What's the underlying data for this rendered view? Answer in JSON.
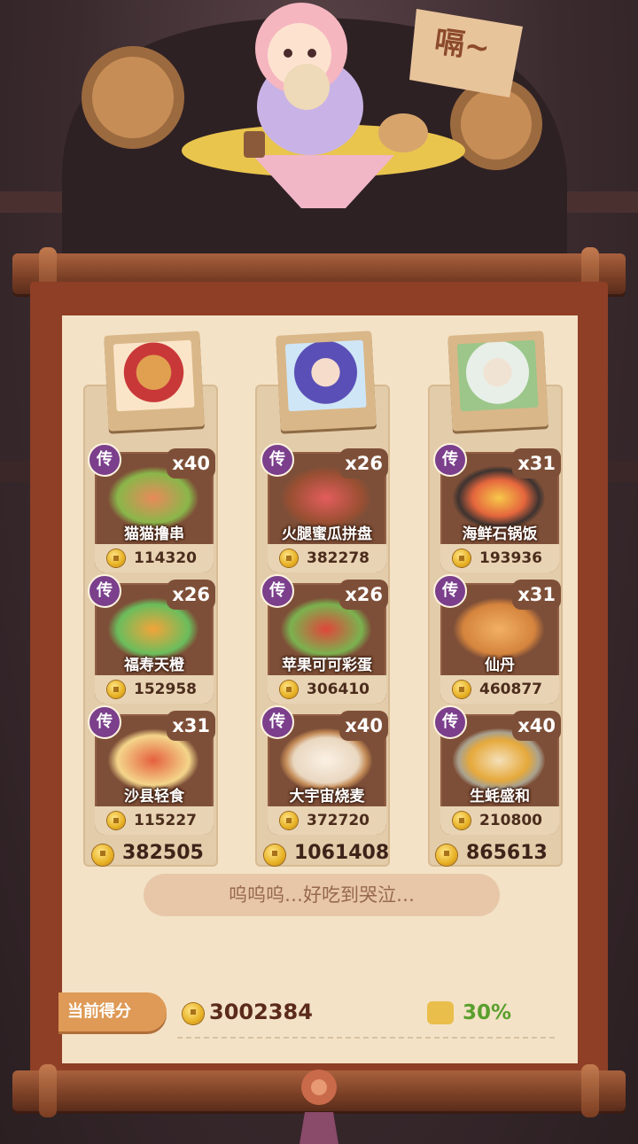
{
  "speech_bubble": "嗝~",
  "columns": [
    {
      "total": "382505",
      "dishes": [
        {
          "badge": "传",
          "qty": "x40",
          "name": "猫猫撸串",
          "price": "114320"
        },
        {
          "badge": "传",
          "qty": "x26",
          "name": "福寿天橙",
          "price": "152958"
        },
        {
          "badge": "传",
          "qty": "x31",
          "name": "沙县轻食",
          "price": "115227"
        }
      ]
    },
    {
      "total": "1061408",
      "dishes": [
        {
          "badge": "传",
          "qty": "x26",
          "name": "火腿蜜瓜拼盘",
          "price": "382278"
        },
        {
          "badge": "传",
          "qty": "x26",
          "name": "苹果可可彩蛋",
          "price": "306410"
        },
        {
          "badge": "传",
          "qty": "x40",
          "name": "大宇宙烧麦",
          "price": "372720"
        }
      ]
    },
    {
      "total": "865613",
      "dishes": [
        {
          "badge": "传",
          "qty": "x31",
          "name": "海鲜石锅饭",
          "price": "193936"
        },
        {
          "badge": "传",
          "qty": "x31",
          "name": "仙丹",
          "price": "460877"
        },
        {
          "badge": "传",
          "qty": "x40",
          "name": "生蚝盛和",
          "price": "210800"
        }
      ]
    }
  ],
  "comment": "呜呜呜…好吃到哭泣…",
  "score": {
    "label": "当前得分",
    "value": "3002384",
    "bonus": "30%"
  },
  "colors": {
    "badge": "#7b3f8c",
    "bonus": "#5a9f2e",
    "scroll": "#8e3f26",
    "paper": "#f3e2c6"
  }
}
